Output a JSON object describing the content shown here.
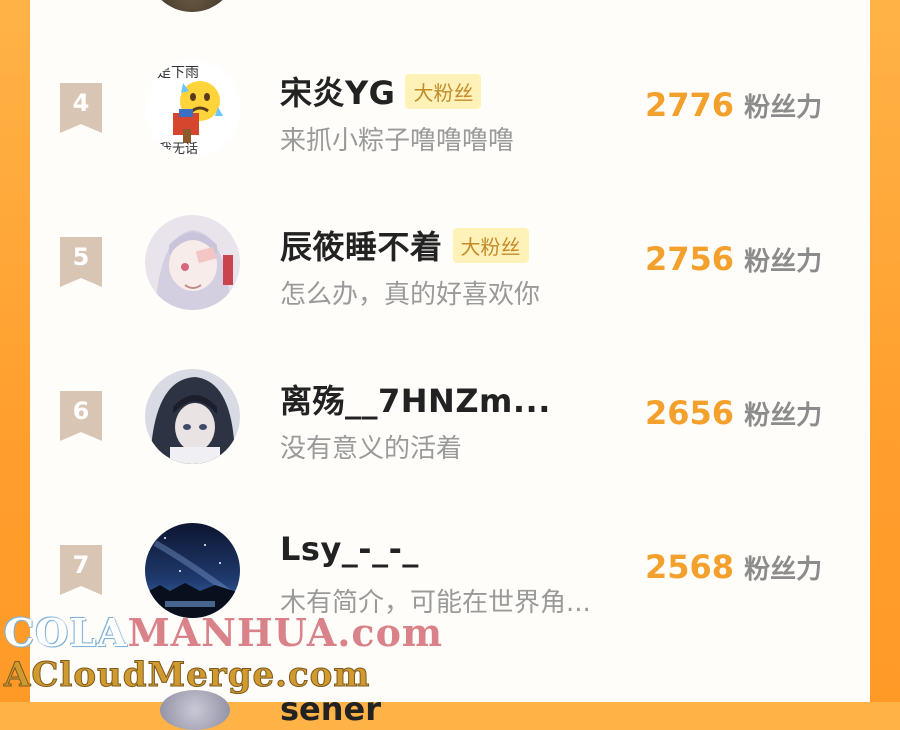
{
  "rows": [
    {
      "rank": "4",
      "name": "宋炎YG",
      "badge": "大粉丝",
      "bio": "来抓小粽子噜噜噜噜",
      "score": "2776",
      "score_unit": "粉丝力",
      "avatar_icon": "emoji-sweat-avatar",
      "avatar_text_top": "是下雨",
      "avatar_text_bottom": "我无话"
    },
    {
      "rank": "5",
      "name": "辰筱睡不着",
      "badge": "大粉丝",
      "bio": "怎么办，真的好喜欢你",
      "score": "2756",
      "score_unit": "粉丝力",
      "avatar_icon": "anime-girl-avatar"
    },
    {
      "rank": "6",
      "name": "离殇__7HNZm...",
      "badge": "",
      "bio": "没有意义的活着",
      "score": "2656",
      "score_unit": "粉丝力",
      "avatar_icon": "hooded-character-avatar"
    },
    {
      "rank": "7",
      "name": "Lsy_-_-_",
      "badge": "",
      "bio": "木有简介，可能在世界角...",
      "score": "2568",
      "score_unit": "粉丝力",
      "avatar_icon": "starry-night-avatar"
    }
  ],
  "partial_next_name": "sener",
  "watermark": {
    "line1_part1": "COLA",
    "line1_part2": "MANHUA.com",
    "line2": "ACloudMerge.com"
  },
  "colors": {
    "background": "#ffa63a",
    "panel": "#fffdf9",
    "score": "#f3a02d",
    "badge_bg": "#fff2b8",
    "badge_text": "#c48b2a",
    "rank_badge": "#d9c5b4"
  }
}
